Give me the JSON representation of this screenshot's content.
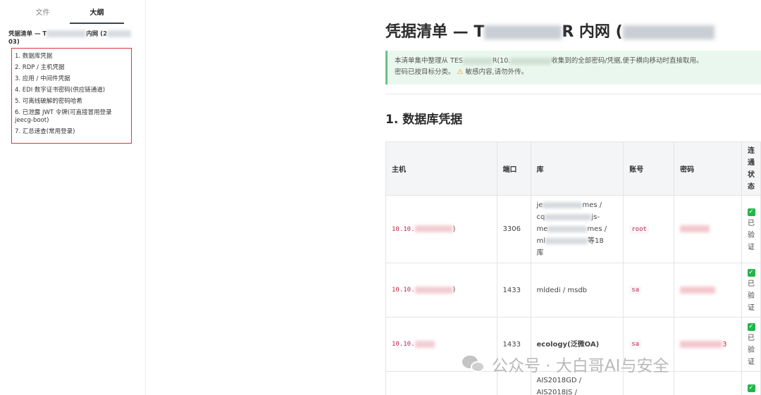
{
  "sidebar": {
    "tabs": [
      {
        "label": "文件",
        "active": false
      },
      {
        "label": "大纲",
        "active": true
      }
    ],
    "toc_title_start": "凭据清单 — T",
    "toc_title_middle": "内网 (2",
    "toc_title_end": "03)",
    "items": [
      {
        "label": "1. 数据库凭据"
      },
      {
        "label": "2. RDP / 主机凭据"
      },
      {
        "label": "3. 应用 / 中间件凭据"
      },
      {
        "label": "4. EDI 数字证书密码(供应链通道)"
      },
      {
        "label": "5. 可离线破解的密码哈希"
      },
      {
        "label": "6. 已泄露 JWT 令牌(可直接冒用登录 jeecg-boot)"
      },
      {
        "label": "7. 汇总速查(常用登录)"
      }
    ]
  },
  "main": {
    "title_start": "凭据清单 — T",
    "title_end": "R 内网 (",
    "notice_line1_a": "本清单集中整理从 TES",
    "notice_line1_b": "R(10.",
    "notice_line1_c": "收集到的全部密码/凭据,便于横向移动时直接取用。",
    "notice_line2_a": "密码已按目标分类。",
    "notice_line2_b": "敏感内容,请勿外传。",
    "section_title": "1. 数据库凭据",
    "table": {
      "headers": [
        "主机",
        "端口",
        "库",
        "账号",
        "密码"
      ],
      "status_header_chars": [
        "连",
        "通",
        "状",
        "态"
      ],
      "status_chars": [
        "已",
        "验",
        "证"
      ],
      "rows": [
        {
          "ip_prefix": "10.10.",
          "ip_suffix": ")",
          "port": "3306",
          "db_lines": [
            "je",
            "mes /",
            "cq",
            "js-",
            "me",
            "mes /",
            "ml",
            "等18",
            "库"
          ],
          "account": "root"
        },
        {
          "ip_prefix": "10.10.",
          "ip_suffix": ")",
          "port": "1433",
          "db": "mldedi / msdb",
          "account": "sa"
        },
        {
          "ip_prefix": "10.10.",
          "ip_suffix": "",
          "port": "1433",
          "db": "ecology(泛微OA)",
          "account": "sa",
          "pwd_tail": "3"
        },
        {
          "db_lines": [
            "AIS2018GD /",
            "AIS2018JS /"
          ]
        }
      ]
    }
  },
  "watermark": {
    "text": "公众号 · 大白哥AI与安全"
  }
}
